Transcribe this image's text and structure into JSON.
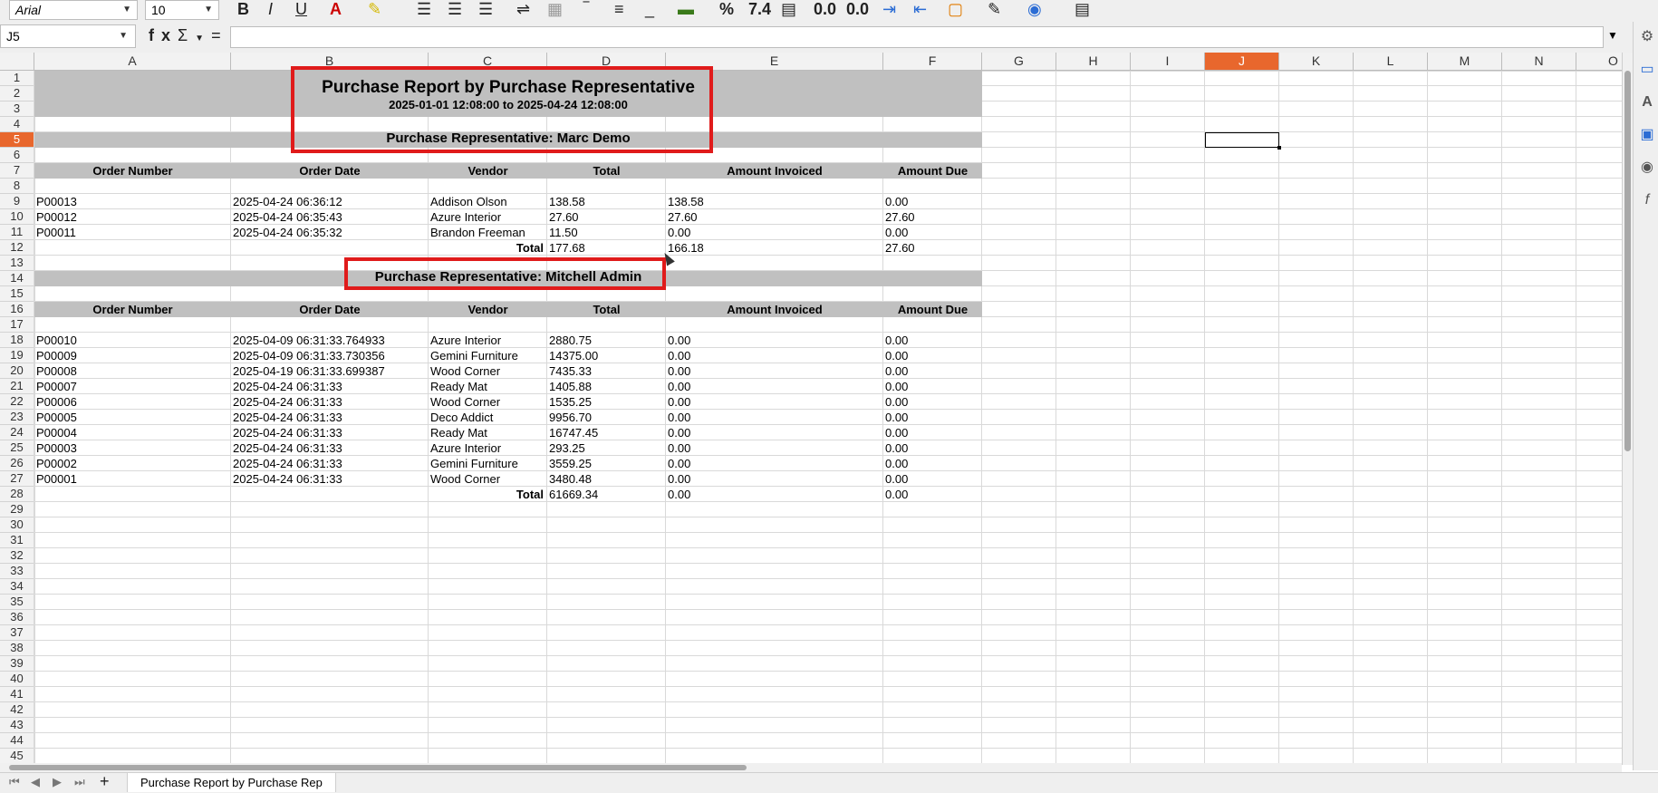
{
  "toolbar": {
    "font_name": "Arial",
    "font_size": "10",
    "bold_label": "B",
    "italic_label": "I",
    "underline_label": "U",
    "percent_label": "%",
    "number_format_label": "7.4",
    "add_decimal_label": "0.0",
    "remove_decimal_label": "0.0"
  },
  "formula_bar": {
    "name_box": "J5",
    "function_wizard_label": "fx",
    "sum_label": "Σ",
    "equals_label": "=",
    "formula": ""
  },
  "columns": [
    {
      "label": "A",
      "active": false
    },
    {
      "label": "B",
      "active": false
    },
    {
      "label": "C",
      "active": false
    },
    {
      "label": "D",
      "active": false
    },
    {
      "label": "E",
      "active": false
    },
    {
      "label": "F",
      "active": false
    },
    {
      "label": "G",
      "active": false
    },
    {
      "label": "H",
      "active": false
    },
    {
      "label": "I",
      "active": false
    },
    {
      "label": "J",
      "active": true
    },
    {
      "label": "K",
      "active": false
    },
    {
      "label": "L",
      "active": false
    },
    {
      "label": "M",
      "active": false
    },
    {
      "label": "N",
      "active": false
    },
    {
      "label": "O",
      "active": false
    }
  ],
  "active_row": 5,
  "row_count": 45,
  "report": {
    "title": "Purchase Report by Purchase Representative",
    "date_range": "2025-01-01 12:08:00 to 2025-04-24 12:08:00",
    "headers": [
      "Order Number",
      "Order Date",
      "Vendor",
      "Total",
      "Amount Invoiced",
      "Amount Due"
    ],
    "total_label": "Total",
    "groups": [
      {
        "rep_label": "Purchase Representative: Marc Demo",
        "rows": [
          [
            "P00013",
            "2025-04-24 06:36:12",
            "Addison Olson",
            "138.58",
            "138.58",
            "0.00"
          ],
          [
            "P00012",
            "2025-04-24 06:35:43",
            "Azure Interior",
            "27.60",
            "27.60",
            "27.60"
          ],
          [
            "P00011",
            "2025-04-24 06:35:32",
            "Brandon Freeman",
            "11.50",
            "0.00",
            "0.00"
          ]
        ],
        "totals": [
          "177.68",
          "166.18",
          "27.60"
        ]
      },
      {
        "rep_label": "Purchase Representative: Mitchell Admin",
        "rows": [
          [
            "P00010",
            "2025-04-09 06:31:33.764933",
            "Azure Interior",
            "2880.75",
            "0.00",
            "0.00"
          ],
          [
            "P00009",
            "2025-04-09 06:31:33.730356",
            "Gemini Furniture",
            "14375.00",
            "0.00",
            "0.00"
          ],
          [
            "P00008",
            "2025-04-19 06:31:33.699387",
            "Wood Corner",
            "7435.33",
            "0.00",
            "0.00"
          ],
          [
            "P00007",
            "2025-04-24 06:31:33",
            "Ready Mat",
            "1405.88",
            "0.00",
            "0.00"
          ],
          [
            "P00006",
            "2025-04-24 06:31:33",
            "Wood Corner",
            "1535.25",
            "0.00",
            "0.00"
          ],
          [
            "P00005",
            "2025-04-24 06:31:33",
            "Deco Addict",
            "9956.70",
            "0.00",
            "0.00"
          ],
          [
            "P00004",
            "2025-04-24 06:31:33",
            "Ready Mat",
            "16747.45",
            "0.00",
            "0.00"
          ],
          [
            "P00003",
            "2025-04-24 06:31:33",
            "Azure Interior",
            "293.25",
            "0.00",
            "0.00"
          ],
          [
            "P00002",
            "2025-04-24 06:31:33",
            "Gemini Furniture",
            "3559.25",
            "0.00",
            "0.00"
          ],
          [
            "P00001",
            "2025-04-24 06:31:33",
            "Wood Corner",
            "3480.48",
            "0.00",
            "0.00"
          ]
        ],
        "totals": [
          "61669.34",
          "0.00",
          "0.00"
        ]
      }
    ]
  },
  "sheet_tabs": {
    "add_label": "+",
    "active_tab": "Purchase Report by Purchase Rep"
  },
  "colors": {
    "accent": "#e8672d",
    "highlight_box": "#e01b1b",
    "band": "#c0c0c0"
  }
}
